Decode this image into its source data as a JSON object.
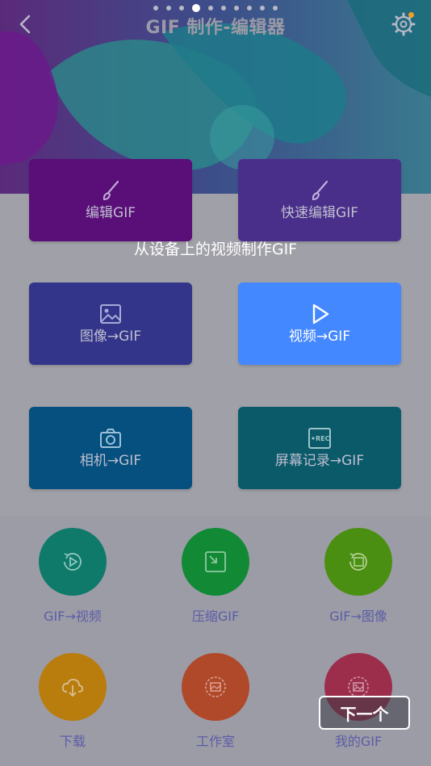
{
  "header": {
    "title": "GIF 制作-编辑器",
    "back_icon": "back-chevron-icon",
    "settings_icon": "gear-icon",
    "page_indicator": {
      "count": 10,
      "active_index": 3
    }
  },
  "tooltip": "从设备上的视频制作GIF",
  "cards": [
    {
      "label": "编辑GIF",
      "icon": "brush-icon",
      "color": "#5a0e78"
    },
    {
      "label": "快速编辑GIF",
      "icon": "brush-icon",
      "color": "#4a2f8a"
    },
    {
      "label": "图像→GIF",
      "icon": "image-icon",
      "color": "#33358a"
    },
    {
      "label": "视频→GIF",
      "icon": "play-icon",
      "color": "#4488ff"
    },
    {
      "label": "相机→GIF",
      "icon": "camera-icon",
      "color": "#05507e"
    },
    {
      "label": "屏幕记录→GIF",
      "icon": "rec-icon",
      "color": "#0a5a6a"
    }
  ],
  "tools": [
    {
      "label": "GIF→视频",
      "icon": "gif-to-video-icon",
      "color": "#0f7a6a"
    },
    {
      "label": "压缩GIF",
      "icon": "compress-icon",
      "color": "#128a35"
    },
    {
      "label": "GIF→图像",
      "icon": "gif-to-image-icon",
      "color": "#4a8f12"
    },
    {
      "label": "下载",
      "icon": "download-cloud-icon",
      "color": "#b97d0e"
    },
    {
      "label": "工作室",
      "icon": "studio-icon",
      "color": "#b0492a"
    },
    {
      "label": "我的GIF",
      "icon": "my-gif-icon",
      "color": "#9c2e4c"
    }
  ],
  "next_button": "下一个"
}
